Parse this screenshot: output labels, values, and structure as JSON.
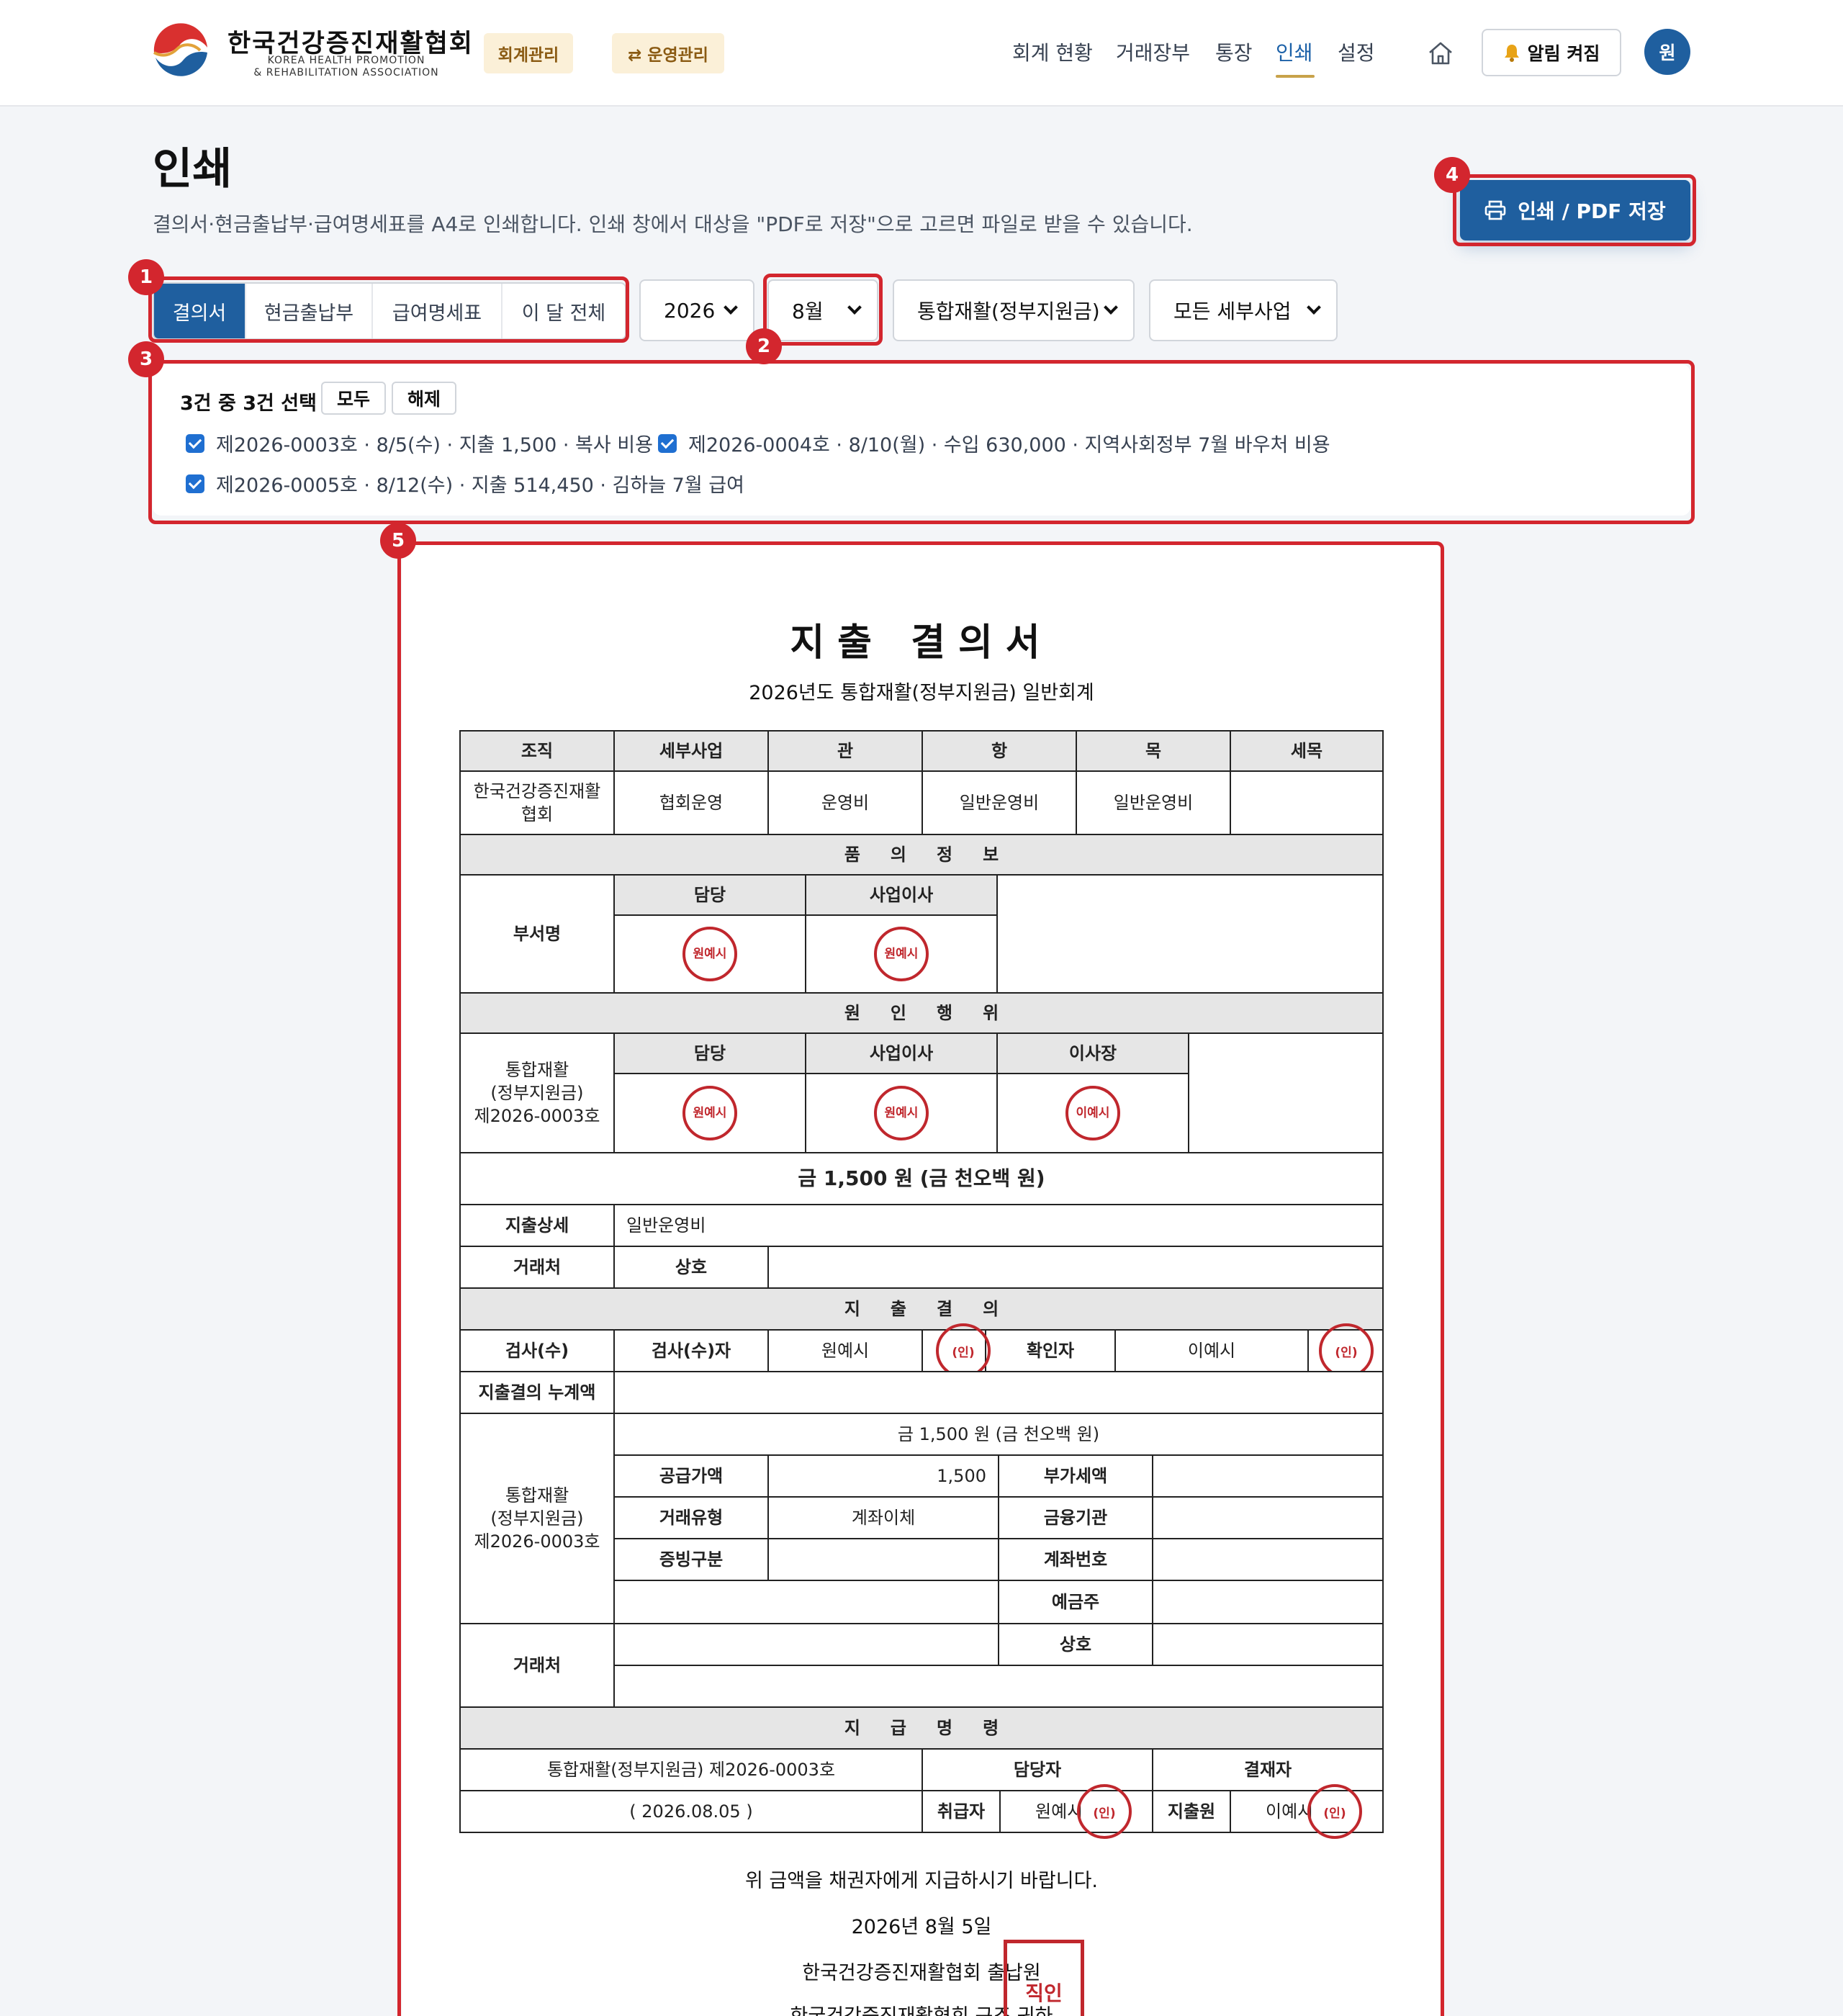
{
  "header": {
    "org_name_ko": "한국건강증진재활협회",
    "org_name_en_1": "KOREA HEALTH PROMOTION",
    "org_name_en_2": "& REHABILITATION ASSOCIATION",
    "chip_accounting": "회계관리",
    "chip_operations": "⇄ 운영관리",
    "nav": [
      "회계 현황",
      "거래장부",
      "통장",
      "인쇄",
      "설정"
    ],
    "active_nav": "인쇄",
    "alert_label": "알림 켜짐",
    "avatar_initial": "원"
  },
  "page": {
    "title": "인쇄",
    "description": "결의서·현금출납부·급여명세표를 A4로 인쇄합니다. 인쇄 창에서 대상을 \"PDF로 저장\"으로 고르면 파일로 받을 수 있습니다.",
    "print_button": "인쇄 / PDF 저장"
  },
  "controls": {
    "doc_types": [
      "결의서",
      "현금출납부",
      "급여명세표",
      "이 달 전체"
    ],
    "active_doc_type": "결의서",
    "year": "2026",
    "month": "8월",
    "account": "통합재활(정부지원금)",
    "subproject": "모든 세부사업"
  },
  "selection": {
    "summary": "3건 중 3건 선택",
    "select_all": "모두",
    "clear": "해제",
    "items": [
      "제2026-0003호 · 8/5(수) · 지출 1,500 · 복사 비용",
      "제2026-0004호 · 8/10(월) · 수입 630,000 · 지역사회정부 7월 바우처 비용",
      "제2026-0005호 · 8/12(수) · 지출 514,450 · 김하늘 7월 급여"
    ]
  },
  "annotations": [
    "1",
    "2",
    "3",
    "4",
    "5"
  ],
  "document": {
    "title": "지출 결의서",
    "subtitle": "2026년도 통합재활(정부지원금) 일반회계",
    "budget_headers": [
      "조직",
      "세부사업",
      "관",
      "항",
      "목",
      "세목"
    ],
    "budget_values": [
      "한국건강증진재활협회",
      "협회운영",
      "운영비",
      "일반운영비",
      "일반운영비",
      ""
    ],
    "proposal_section": "품의정보",
    "dept_label": "부서명",
    "role_manager": "담당",
    "role_director": "사업이사",
    "role_chair": "이사장",
    "cause_section": "원인행위",
    "cause_label_1": "통합재활",
    "cause_label_2": "(정부지원금)",
    "cause_label_3": "제2026-0003호",
    "stamp_won": "원예시",
    "stamp_lee": "이예시",
    "stamp_seal": "(인)",
    "amount_line": "금 1,500 원 (금 천오백 원)",
    "detail_label": "지출상세",
    "detail_value": "일반운영비",
    "vendor_label": "거래처",
    "vendor_name_label": "상호",
    "resolution_section": "지출결의",
    "auditor_label": "검사(수)",
    "auditor_person_label": "검사(수)자",
    "auditor_name": "원예시",
    "confirmer_label": "확인자",
    "confirmer_name": "이예시",
    "cumulative_label": "지출결의 누계액",
    "supply_label": "공급가액",
    "supply_value": "1,500",
    "vat_label": "부가세액",
    "tx_type_label": "거래유형",
    "tx_type_value": "계좌이체",
    "bank_label": "금융기관",
    "proof_label": "증빙구분",
    "account_no_label": "계좌번호",
    "holder_label": "예금주",
    "payment_section": "지급명령",
    "payment_ref": "통합재활(정부지원금) 제2026-0003호",
    "payment_date": "( 2026.08.05 )",
    "manager_label": "담당자",
    "approver_label": "결재자",
    "handler_label": "취급자",
    "handler_name": "원예시",
    "payer_label": "지출원",
    "payer_name": "이예시",
    "closing_text": "위 금액을 채권자에게 지급하시기 바랍니다.",
    "closing_date": "2026년  8월  5일",
    "closing_org": "한국건강증진재활협회  출납원",
    "closing_org_2": "한국건강증진재활협회  구조 귀하",
    "seal_text": "직인"
  },
  "colors": {
    "brand": "#1f5f9f",
    "accent": "#c8a24a",
    "highlight": "#d3262e",
    "stamp": "#c0272d"
  }
}
